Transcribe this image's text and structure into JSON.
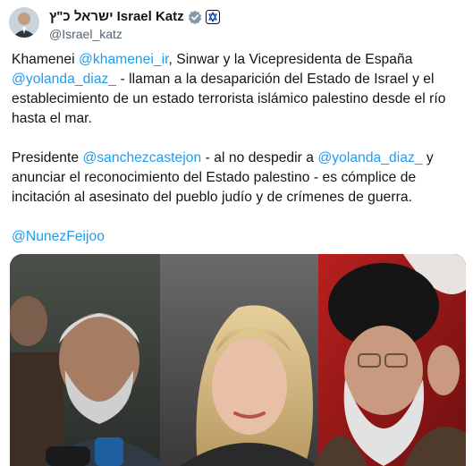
{
  "author": {
    "name_hebrew": "ישראל כ\"ץ",
    "name": "Israel Katz",
    "handle": "@Israel_katz",
    "verified_icon": "verified-badge-icon",
    "affiliation_icon": "government-badge-icon"
  },
  "tweet": {
    "p1": {
      "t1": "Khamenei ",
      "m1": "@khamenei_ir",
      "t2": ", Sinwar y la Vicepresidenta de España ",
      "m2": "@yolanda_diaz_",
      "t3": " - llaman a la desaparición del Estado de Israel y el establecimiento de un estado terrorista islámico palestino desde el río hasta el mar."
    },
    "p2": {
      "t1": "Presidente ",
      "m1": "@sanchezcastejon",
      "t2": " - al no despedir a ",
      "m2": "@yolanda_diaz_",
      "t3": " y anunciar el reconocimiento del Estado palestino - es cómplice de incitación al asesinato del pueblo judío y de crímenes de guerra."
    },
    "p3": {
      "m1": "@NunezFeijoo"
    }
  },
  "colors": {
    "link": "#1d9bf0",
    "text": "#0f1419",
    "secondary": "#536471",
    "verified": "#1d9bf0"
  }
}
